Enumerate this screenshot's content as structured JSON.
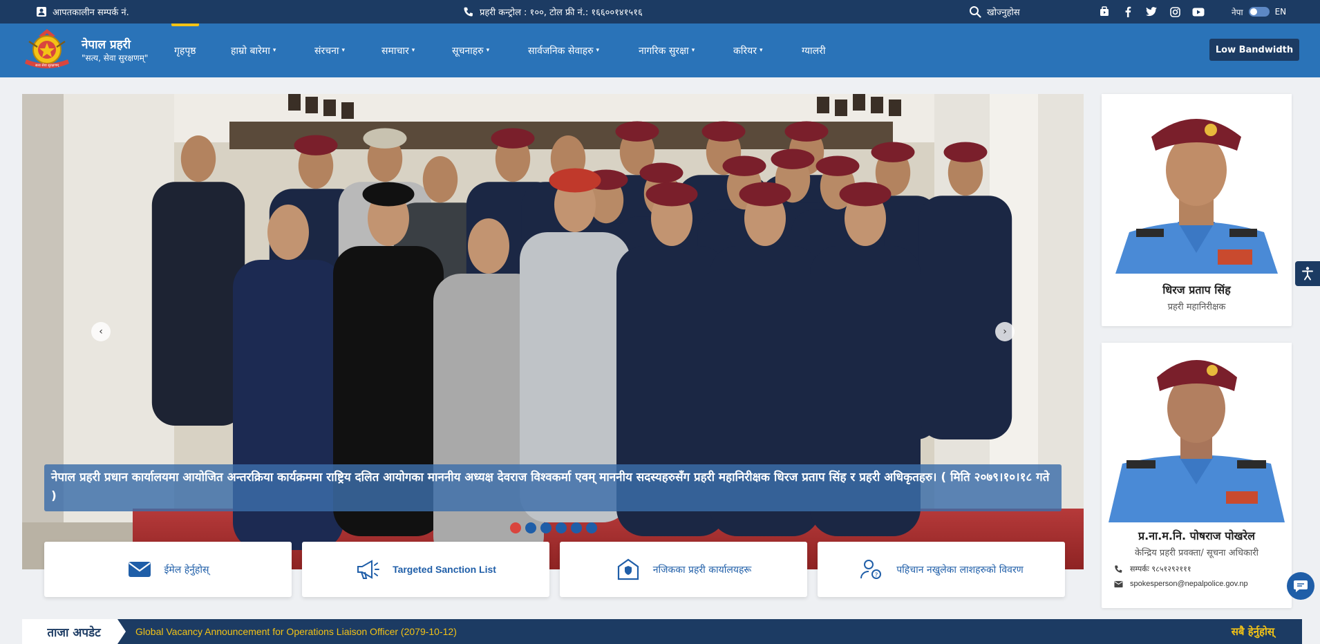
{
  "topbar": {
    "emergency_label": "आपतकालीन सम्पर्क नं.",
    "hotline_label": "प्रहरी कन्ट्रोल : १००, टोल फ्री नं.: १६६००१४१५१६",
    "search_label": "खोज्नुहोस",
    "lang_np": "नेपा",
    "lang_en": "EN",
    "social_icons": [
      "play-store-icon",
      "facebook-icon",
      "twitter-icon",
      "instagram-icon",
      "youtube-icon"
    ]
  },
  "brand": {
    "name": "नेपाल प्रहरी",
    "tagline": "\"सत्य, सेवा सुरक्षणम्\"",
    "logo_text_top": "नेपाल प्रहरी",
    "logo_text_bottom": "सत्य सेवा सुरक्षणम्"
  },
  "nav": {
    "items": [
      {
        "label": "गृहपृष्ठ",
        "active": true
      },
      {
        "label": "हाम्रो बारेमा",
        "dropdown": true
      },
      {
        "label": "संरचना",
        "dropdown": true
      },
      {
        "label": "समाचार",
        "dropdown": true
      },
      {
        "label": "सूचनाहरु",
        "dropdown": true
      },
      {
        "label": "सार्वजनिक सेवाहरु",
        "dropdown": true
      },
      {
        "label": "नागरिक सुरक्षा",
        "dropdown": true
      },
      {
        "label": "करियर",
        "dropdown": true
      },
      {
        "label": "ग्यालरी"
      }
    ],
    "low_bandwidth_label": "Low Bandwidth",
    "caret": "▾"
  },
  "slider": {
    "caption": "नेपाल प्रहरी प्रधान कार्यालयमा आयोजित अन्तरक्रिया कार्यक्रममा राष्ट्रिय दलित आयोगका माननीय अध्यक्ष देवराज विश्वकर्मा एवम् माननीय सदस्यहरुसँग प्रहरी महानिरीक्षक धिरज प्रताप सिंह र प्रहरी अधिकृतहरु। ( मिति २०७९।१०।१८ गते )",
    "prev": "‹",
    "next": "›",
    "slide_count": 6,
    "active_slide": 0
  },
  "quick_links": [
    {
      "label": "ईमेल हेर्नुहोस्",
      "icon": "envelope-icon"
    },
    {
      "label": "Targeted Sanction List",
      "icon": "megaphone-icon"
    },
    {
      "label": "नजिकका प्रहरी कार्यालयहरू",
      "icon": "police-station-icon"
    },
    {
      "label": "पहिचान नखुलेका लाशहरुको विवरण",
      "icon": "person-search-icon"
    }
  ],
  "chief_card": {
    "name": "धिरज प्रताप सिंह",
    "role": "प्रहरी महानिरीक्षक"
  },
  "spokesperson_card": {
    "name": "प्र.ना.म.नि. पोषराज पोखरेल",
    "role": "केन्द्रिय प्रहरी प्रवक्ता/ सूचना अधिकारी",
    "phone": "सम्पर्कः ९८५१२९२१११",
    "email": "spokesperson@nepalpolice.gov.np"
  },
  "ticker": {
    "label": "ताजा अपडेट",
    "text": "Global Vacancy Announcement for Operations Liaison Officer (2079-10-12)",
    "more": "सबै हेर्नुहोस्"
  },
  "colors": {
    "topbar": "#1c3b63",
    "navbar": "#2a73b8",
    "accent": "#f3c316",
    "dot_active": "#d9453e",
    "dot": "#1f5ea8"
  }
}
